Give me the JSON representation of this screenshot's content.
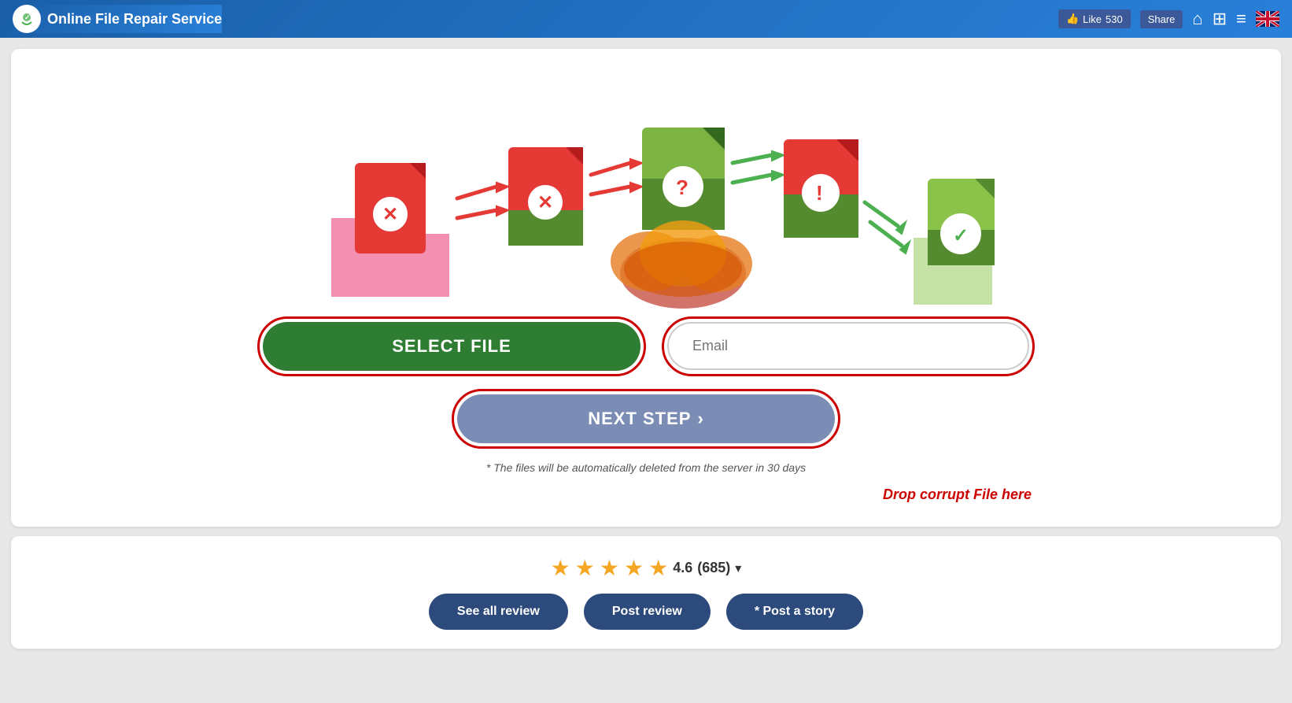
{
  "header": {
    "logo_alt": "Online File Repair Service",
    "title": "Online File Repair Service",
    "fb_like": "Like",
    "fb_count": "530",
    "fb_share": "Share",
    "icons": [
      "home-icon",
      "apps-icon",
      "menu-icon",
      "flag-icon"
    ]
  },
  "illustration": {
    "alt": "File repair process illustration showing corrupt file going through cloud and being repaired"
  },
  "actions": {
    "select_file_label": "SELECT FILE",
    "email_placeholder": "Email",
    "next_step_label": "NEXT STEP",
    "next_step_chevron": "›",
    "disclaimer": "* The files will be automatically deleted from the server in 30 days",
    "drop_text": "Drop corrupt File here"
  },
  "reviews": {
    "rating": "4.6",
    "count": "(685)",
    "dropdown_icon": "▾",
    "buttons": [
      {
        "label": "See all review",
        "id": "see-all-review"
      },
      {
        "label": "Post review",
        "id": "post-review"
      },
      {
        "label": "* Post a story",
        "id": "post-story"
      }
    ]
  }
}
